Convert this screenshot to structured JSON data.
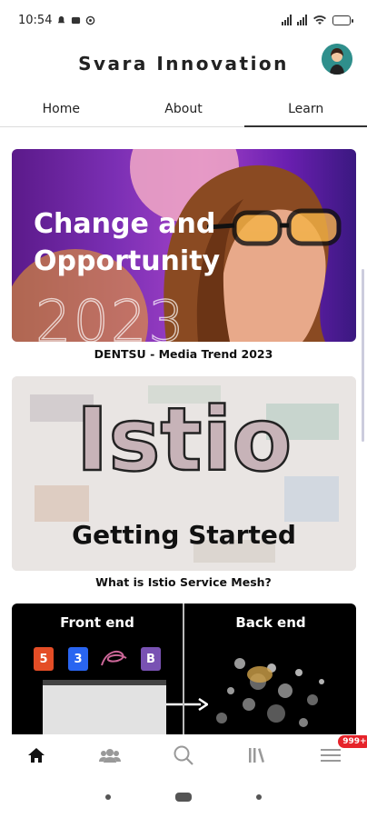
{
  "status_bar": {
    "time": "10:54"
  },
  "header": {
    "app_title": "Svara Innovation"
  },
  "tabs": [
    {
      "label": "Home",
      "active": false
    },
    {
      "label": "About",
      "active": false
    },
    {
      "label": "Learn",
      "active": true
    }
  ],
  "feed": {
    "cards": [
      {
        "title_line1": "Change and",
        "title_line2": "Opportunity",
        "year": "2023",
        "caption": "DENTSU - Media Trend 2023"
      },
      {
        "big_text": "Istio",
        "sub_text": "Getting Started",
        "caption": "What is Istio Service Mesh?"
      },
      {
        "left_label": "Front end",
        "right_label": "Back end",
        "badges": [
          "5",
          "3",
          "B"
        ]
      }
    ]
  },
  "bottom_nav": {
    "notification_badge": "999+"
  },
  "colors": {
    "accent": "#e6232a",
    "active_tab": "#333333"
  }
}
